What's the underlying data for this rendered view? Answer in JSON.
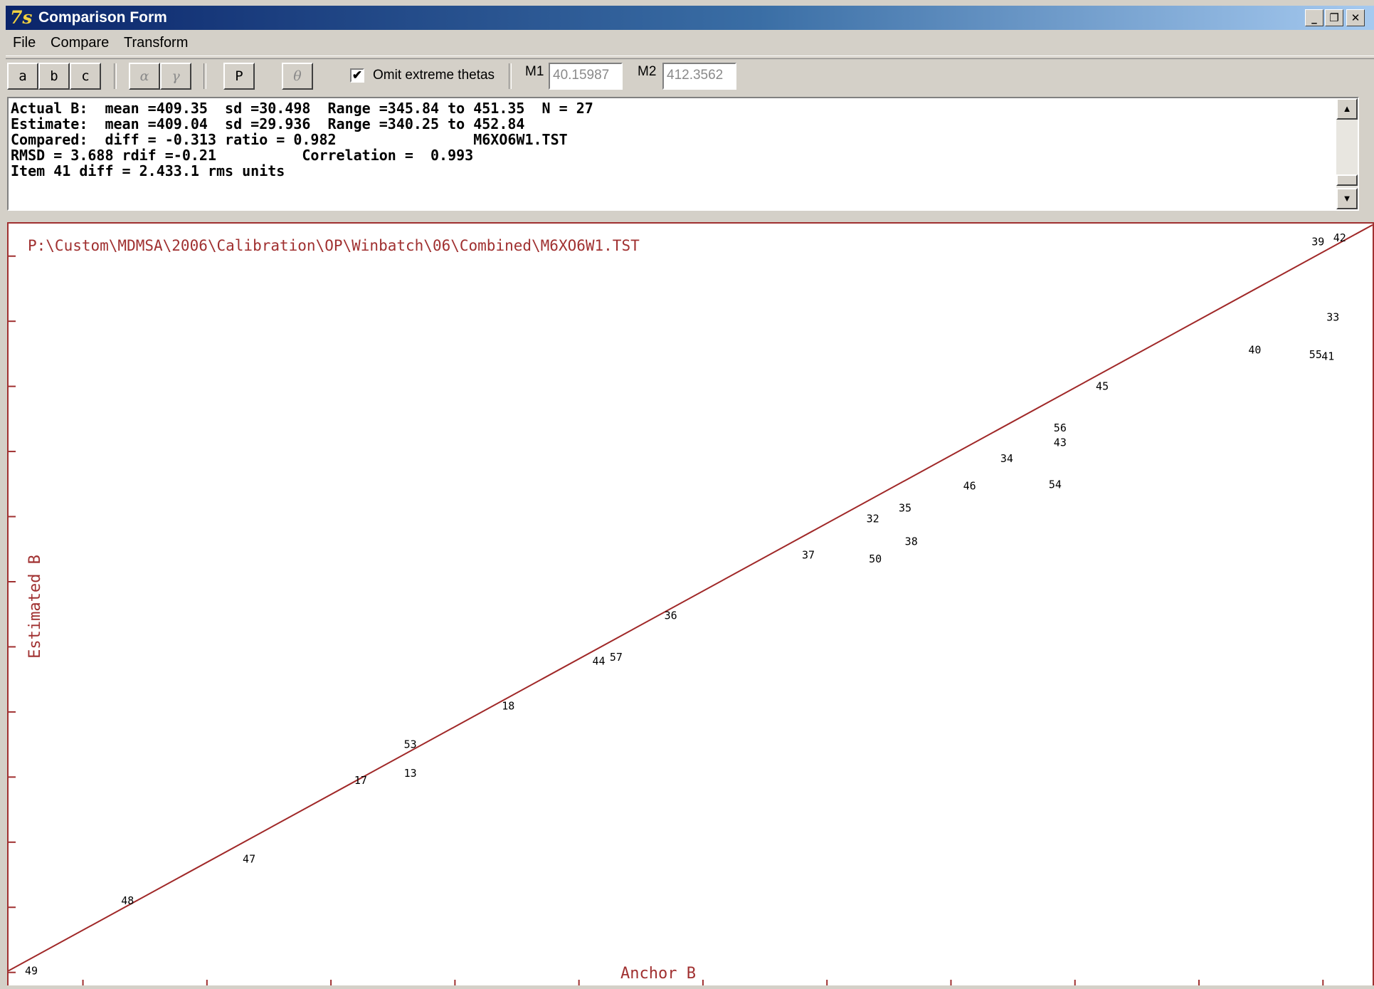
{
  "window": {
    "logo_text": "7s",
    "title": "Comparison Form",
    "min_glyph": "_",
    "max_glyph": "❐",
    "close_glyph": "✕"
  },
  "menu": [
    "File",
    "Compare",
    "Transform"
  ],
  "toolbar": {
    "btn_a": "a",
    "btn_b": "b",
    "btn_c": "c",
    "btn_alpha": "α",
    "btn_gamma": "γ",
    "btn_p": "P",
    "btn_theta": "θ",
    "omit_checked_glyph": "✔",
    "omit_label": "Omit extreme thetas",
    "m1_label": "M1",
    "m1_value": "40.15987",
    "m2_label": "M2",
    "m2_value": "412.3562"
  },
  "stats": {
    "line1": "Actual B:  mean =409.35  sd =30.498  Range =345.84 to 451.35  N = 27",
    "line2": "Estimate:  mean =409.04  sd =29.936  Range =340.25 to 452.84",
    "line3": "Compared:  diff = -0.313 ratio = 0.982                M6XO6W1.TST",
    "line4": "RMSD = 3.688 rdif =-0.21          Correlation =  0.993",
    "line5": "Item 41 diff = 2.433.1 rms units",
    "scroll_up": "▲",
    "scroll_down": "▼"
  },
  "chart_data": {
    "type": "scatter",
    "title": "P:\\Custom\\MDMSA\\2006\\Calibration\\OP\\Winbatch\\06\\Combined\\M6XO6W1.TST",
    "xlabel": "Anchor B",
    "ylabel": "Estimated B",
    "xlim": [
      344,
      454
    ],
    "ylim": [
      338,
      455
    ],
    "x_ticks": [
      350,
      360,
      370,
      380,
      390,
      400,
      410,
      420,
      430,
      440,
      450
    ],
    "y_ticks": [
      340,
      350,
      360,
      370,
      380,
      390,
      400,
      410,
      420,
      430,
      440,
      450
    ],
    "tick_labels_shown": false,
    "grid": false,
    "line": {
      "x": [
        344,
        454
      ],
      "y": [
        340.25,
        454.8
      ]
    },
    "series": [
      {
        "values": [
          {
            "label": "49",
            "x": 345.84,
            "y": 340.25
          },
          {
            "label": "48",
            "x": 353.6,
            "y": 351.0
          },
          {
            "label": "47",
            "x": 363.4,
            "y": 357.4
          },
          {
            "label": "17",
            "x": 372.4,
            "y": 369.5
          },
          {
            "label": "13",
            "x": 376.4,
            "y": 370.6
          },
          {
            "label": "53",
            "x": 376.4,
            "y": 375.0
          },
          {
            "label": "18",
            "x": 384.3,
            "y": 380.9
          },
          {
            "label": "44",
            "x": 391.6,
            "y": 387.8
          },
          {
            "label": "57",
            "x": 393.0,
            "y": 388.4
          },
          {
            "label": "36",
            "x": 397.4,
            "y": 394.8
          },
          {
            "label": "37",
            "x": 408.5,
            "y": 404.1
          },
          {
            "label": "32",
            "x": 413.7,
            "y": 409.7
          },
          {
            "label": "50",
            "x": 413.9,
            "y": 403.5
          },
          {
            "label": "35",
            "x": 416.3,
            "y": 411.3
          },
          {
            "label": "38",
            "x": 416.8,
            "y": 406.2
          },
          {
            "label": "46",
            "x": 421.5,
            "y": 414.7
          },
          {
            "label": "34",
            "x": 424.5,
            "y": 418.9
          },
          {
            "label": "54",
            "x": 428.4,
            "y": 414.9
          },
          {
            "label": "56",
            "x": 428.8,
            "y": 423.6
          },
          {
            "label": "43",
            "x": 428.8,
            "y": 421.4
          },
          {
            "label": "45",
            "x": 432.2,
            "y": 430.0
          },
          {
            "label": "40",
            "x": 444.5,
            "y": 435.6
          },
          {
            "label": "55",
            "x": 449.4,
            "y": 434.9
          },
          {
            "label": "41",
            "x": 450.4,
            "y": 434.6
          },
          {
            "label": "39",
            "x": 449.6,
            "y": 452.2
          },
          {
            "label": "33",
            "x": 450.8,
            "y": 440.6
          },
          {
            "label": "42",
            "x": 451.35,
            "y": 452.84
          }
        ]
      }
    ]
  }
}
